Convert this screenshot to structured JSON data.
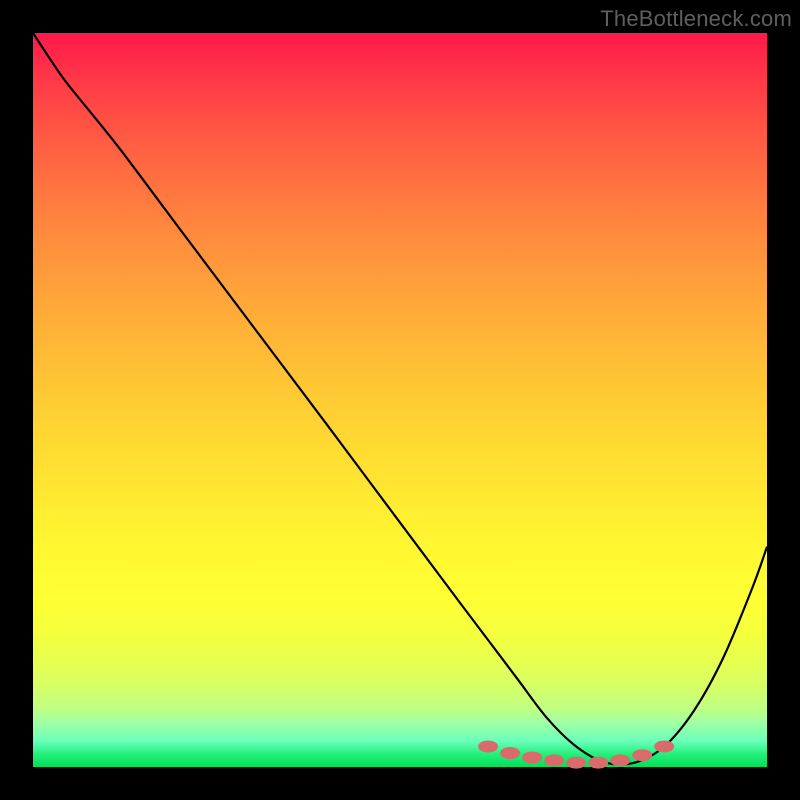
{
  "watermark": "TheBottleneck.com",
  "chart_data": {
    "type": "line",
    "title": "",
    "xlabel": "",
    "ylabel": "",
    "xlim": [
      0,
      100
    ],
    "ylim": [
      0,
      100
    ],
    "gradient_stops": [
      {
        "pct": 0,
        "color": "#ff1a4b"
      },
      {
        "pct": 50,
        "color": "#ffd233"
      },
      {
        "pct": 85,
        "color": "#f8ff3a"
      },
      {
        "pct": 100,
        "color": "#00e05a"
      }
    ],
    "series": [
      {
        "name": "bottleneck-curve",
        "x": [
          0,
          4,
          8,
          12,
          20,
          30,
          40,
          50,
          58,
          62,
          66,
          70,
          74,
          78,
          82,
          86,
          90,
          94,
          98,
          100
        ],
        "y": [
          100,
          94,
          89,
          84,
          73.3,
          60,
          46.7,
          33.3,
          22.6,
          17.3,
          12,
          6.7,
          2.8,
          0.6,
          0.6,
          2.8,
          7.6,
          14.8,
          24.4,
          30
        ]
      }
    ],
    "markers": {
      "name": "emphasis-dots",
      "color": "#d96b6b",
      "x": [
        62,
        65,
        68,
        71,
        74,
        77,
        80,
        83,
        86
      ],
      "y": [
        2.8,
        1.9,
        1.3,
        0.9,
        0.6,
        0.6,
        0.9,
        1.6,
        2.8
      ]
    }
  }
}
